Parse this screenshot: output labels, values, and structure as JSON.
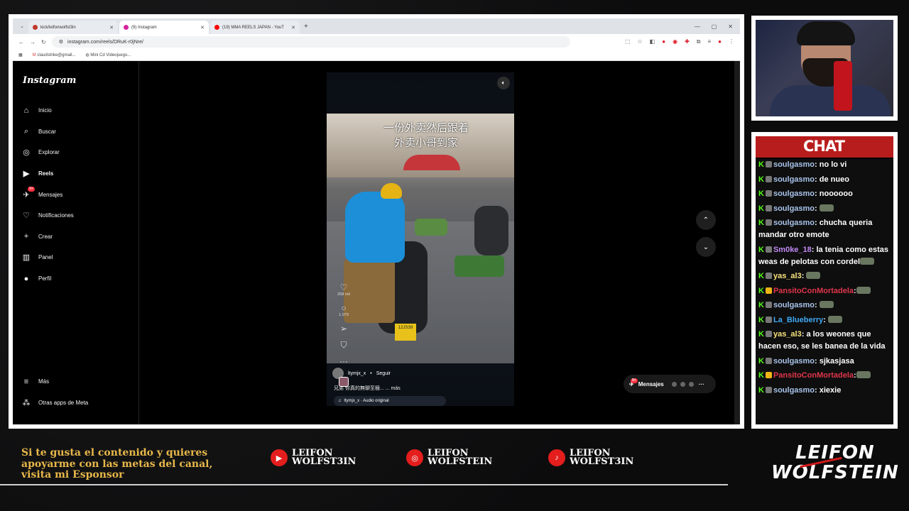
{
  "browser": {
    "tabs": [
      {
        "title": "kick/leifonwolfst3in",
        "fav_color": "#c0392b"
      },
      {
        "title": "(9) Instagram",
        "fav_color": "#d6249f"
      },
      {
        "title": "(19) MMA REELS JAPAN - YouT",
        "fav_color": "#ff0000"
      }
    ],
    "url": "instagram.com/reels/DRuK-r0jNre/",
    "bookmarks": [
      "claudstrike@gmail...",
      "Mini Cd Videojuego..."
    ]
  },
  "instagram": {
    "logo": "Instagram",
    "nav": [
      {
        "label": "Inicio",
        "icon": "home-icon",
        "glyph": "⌂"
      },
      {
        "label": "Buscar",
        "icon": "search-icon",
        "glyph": "⌕"
      },
      {
        "label": "Explorar",
        "icon": "compass-icon",
        "glyph": "◎"
      },
      {
        "label": "Reels",
        "icon": "reels-icon",
        "glyph": "▶"
      },
      {
        "label": "Mensajes",
        "icon": "messenger-icon",
        "glyph": "✈",
        "badge": "9+"
      },
      {
        "label": "Notificaciones",
        "icon": "heart-icon",
        "glyph": "♡"
      },
      {
        "label": "Crear",
        "icon": "plus-icon",
        "glyph": "+"
      },
      {
        "label": "Panel",
        "icon": "chart-icon",
        "glyph": "▥"
      },
      {
        "label": "Perfil",
        "icon": "avatar-icon",
        "glyph": "●"
      }
    ],
    "more_label": "Más",
    "meta_label": "Otras apps de Meta",
    "reel": {
      "caption_overlay_1": "一份外卖然后跟着",
      "caption_overlay_2": "外卖小哥到家",
      "plate": "12JS39",
      "username": "ltymjx_x",
      "follow": "Seguir",
      "caption": "兄弟 你真的無聊至極... ... más",
      "audio": "ltymjx_x · Audio original",
      "likes": "268 mil",
      "comments": "1.079"
    },
    "messages_label": "Mensajes",
    "messages_badge": "9+"
  },
  "chat": {
    "title": "CHAT",
    "messages": [
      {
        "user": "soulgasmo",
        "text": ": no lo vi",
        "ucls": "u1",
        "badges": "k"
      },
      {
        "user": "soulgasmo",
        "text": ": de nueo",
        "ucls": "u1",
        "badges": "k"
      },
      {
        "user": "soulgasmo",
        "text": ": noooooo",
        "ucls": "u1",
        "badges": "k"
      },
      {
        "user": "soulgasmo",
        "text": ": ",
        "ucls": "u1",
        "badges": "k",
        "emote": true
      },
      {
        "user": "soulgasmo",
        "text": ": chucha queria mandar otro emote",
        "ucls": "u1",
        "badges": "k"
      },
      {
        "user": "Sm0ke_18",
        "text": ": la tenia como estas weas de pelotas con cordel",
        "ucls": "u2",
        "badges": "k",
        "emote": true
      },
      {
        "user": "yas_al3",
        "text": ": ",
        "ucls": "u3",
        "badges": "k",
        "emote": true
      },
      {
        "user": "PansitoConMortadela",
        "text": ":",
        "ucls": "u4",
        "badges": "g",
        "emote": true
      },
      {
        "user": "soulgasmo",
        "text": ": ",
        "ucls": "u1",
        "badges": "k",
        "emote": true
      },
      {
        "user": "La_Blueberry",
        "text": ": ",
        "ucls": "u5",
        "badges": "k",
        "emote": true
      },
      {
        "user": "yas_al3",
        "text": ": a los weones que hacen eso, se les banea de la vida",
        "ucls": "u3",
        "badges": "k"
      },
      {
        "user": "soulgasmo",
        "text": ": sjkasjasa",
        "ucls": "u1",
        "badges": "k"
      },
      {
        "user": "PansitoConMortadela",
        "text": ":",
        "ucls": "u4",
        "badges": "g",
        "emote": true
      },
      {
        "user": "soulgasmo",
        "text": ": xiexie",
        "ucls": "u1",
        "badges": "k"
      }
    ]
  },
  "footer": {
    "sponsor_line_1": "Si te gusta el contenido y quieres",
    "sponsor_line_2": "apoyarme con las metas del canal,",
    "sponsor_line_3": "visita mi Esponsor",
    "youtube_1": "LEIFON",
    "youtube_2": "WOLFST3IN",
    "instagram_1": "LEIFON",
    "instagram_2": "WOLFSTEIN",
    "tiktok_1": "LEIFON",
    "tiktok_2": "WOLFST3IN",
    "brand_1": "LEIFON",
    "brand_2": "WOLFSTEIN"
  }
}
